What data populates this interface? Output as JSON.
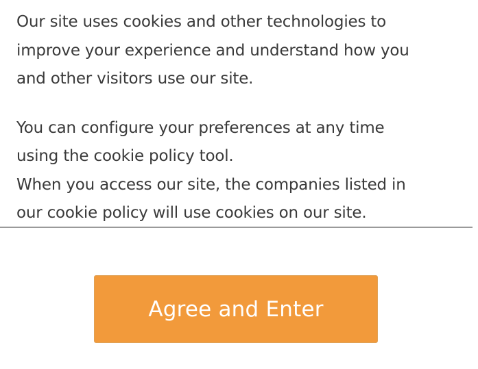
{
  "cookie_notice": {
    "paragraph_1": [
      "Our site uses cookies and other technologies to",
      "improve your experience and understand how you",
      "and other visitors use our site."
    ],
    "paragraph_2": [
      "You can configure your preferences at any time",
      "using the cookie policy tool.",
      "When you access our site, the companies listed in",
      "our cookie policy will use cookies on our site."
    ]
  },
  "actions": {
    "agree_label": "Agree and Enter"
  },
  "colors": {
    "button_background": "#f29a3b",
    "button_text": "#ffffff",
    "body_text": "#3a3a3a",
    "divider": "#9a9a9a"
  }
}
